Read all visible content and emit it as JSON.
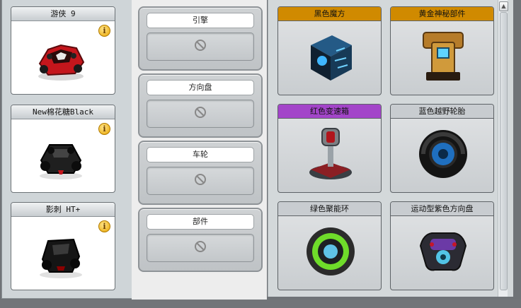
{
  "cars": [
    {
      "name": "游侠 9",
      "color": "#c4161c",
      "icon": "red-kart-icon"
    },
    {
      "name": "New棉花糖Black",
      "color": "#1f1f1f",
      "icon": "black-kart-icon"
    },
    {
      "name": "影刺 HT+",
      "color": "#151515",
      "icon": "black-kart-icon"
    }
  ],
  "info_glyph": "i",
  "slots": [
    {
      "label": "引擎"
    },
    {
      "label": "方向盘"
    },
    {
      "label": "车轮"
    },
    {
      "label": "部件"
    }
  ],
  "items": [
    {
      "name": "黑色魔方",
      "header_color": "#d08a00",
      "icon": "black-cube-icon"
    },
    {
      "name": "黄金神秘部件",
      "header_color": "#d08a00",
      "icon": "gold-part-icon"
    },
    {
      "name": "红色变速箱",
      "header_color": "#a345c9",
      "icon": "gear-shifter-icon"
    },
    {
      "name": "蓝色越野轮胎",
      "header_color": "#c8ccd0",
      "icon": "tire-icon"
    },
    {
      "name": "绿色聚能环",
      "header_color": "#c8ccd0",
      "icon": "green-wheel-icon"
    },
    {
      "name": "运动型紫色方向盘",
      "header_color": "#c8ccd0",
      "icon": "steering-wheel-icon"
    }
  ],
  "scroll_up_glyph": "▲"
}
